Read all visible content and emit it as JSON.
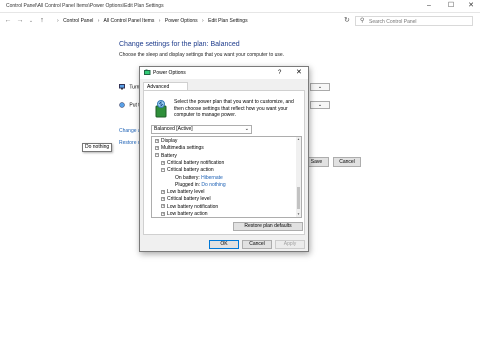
{
  "window": {
    "title": "Control Panel\\All Control Panel Items\\Power Options\\Edit Plan Settings",
    "minimize": "–",
    "maximize": "☐",
    "close": "✕"
  },
  "address": {
    "back": "←",
    "forward": "→",
    "recent": "⌄",
    "up": "↑",
    "crumbs": [
      "Control Panel",
      "All Control Panel Items",
      "Power Options",
      "Edit Plan Settings"
    ],
    "separator": "›",
    "refresh": "↻",
    "search_placeholder": "Search Control Panel"
  },
  "page": {
    "title": "Change settings for the plan: Balanced",
    "subtitle": "Choose the sleep and display settings that you want your computer to use.",
    "row1_label": "Turn",
    "row2_label": "Put t",
    "links": [
      "Change a",
      "Restore d"
    ],
    "save_label": "Save changes",
    "cancel_label": "Cancel"
  },
  "dialog": {
    "title": "Power Options",
    "help": "?",
    "close": "✕",
    "tab": "Advanced settings",
    "description": "Select the power plan that you want to customize, and then choose settings that reflect how you want your computer to manage power.",
    "plan": "Balanced [Active]",
    "tree": [
      {
        "label": "Display",
        "expander": "+",
        "indent": 0
      },
      {
        "label": "Multimedia settings",
        "expander": "+",
        "indent": 0
      },
      {
        "label": "Battery",
        "expander": "−",
        "indent": 0
      },
      {
        "label": "Critical battery notification",
        "expander": "+",
        "indent": 1
      },
      {
        "label": "Critical battery action",
        "expander": "−",
        "indent": 1
      },
      {
        "label": "On battery:",
        "value": "Hibernate",
        "indent": 2
      },
      {
        "label": "Plugged in:",
        "value": "Do nothing",
        "indent": 2
      },
      {
        "label": "Low battery level",
        "expander": "+",
        "indent": 1
      },
      {
        "label": "Critical battery level",
        "expander": "+",
        "indent": 1
      },
      {
        "label": "Low battery notification",
        "expander": "+",
        "indent": 1
      },
      {
        "label": "Low battery action",
        "expander": "+",
        "indent": 1
      }
    ],
    "tooltip": "Do nothing",
    "restore_label": "Restore plan defaults",
    "ok_label": "OK",
    "cancel_label": "Cancel",
    "apply_label": "Apply"
  }
}
